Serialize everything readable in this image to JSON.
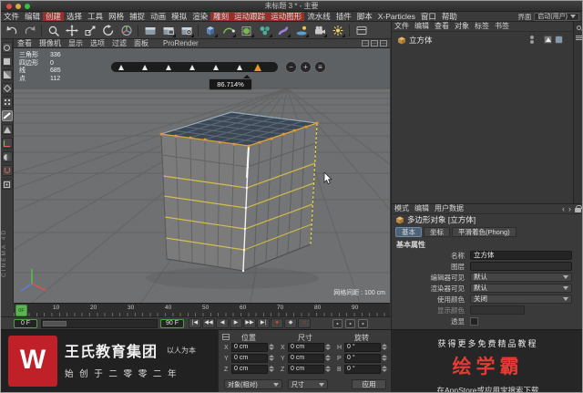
{
  "window": {
    "title": "未标题 3 * - 主要"
  },
  "menubar": {
    "items": [
      "文件",
      "编辑",
      "创建",
      "选择",
      "工具",
      "网格",
      "捕捉",
      "动画",
      "模拟",
      "渲染",
      "雕刻",
      "运动跟踪",
      "运动图形",
      "流水线",
      "插件",
      "脚本",
      "X-Particles",
      "窗口",
      "帮助"
    ],
    "interface_label": "界面",
    "interface_value": "启动(用户)"
  },
  "viewport": {
    "menus": [
      "查看",
      "摄像机",
      "显示",
      "选项",
      "过滤",
      "面板"
    ],
    "prorender_menu": "ProRender",
    "stats": [
      {
        "label": "三角形",
        "value": "336"
      },
      {
        "label": "四边形",
        "value": "0"
      },
      {
        "label": "线",
        "value": "685"
      },
      {
        "label": "点",
        "value": "112"
      }
    ],
    "grid_label": "网格间距 : 100 cm",
    "hud_value": "86.714%"
  },
  "object_manager": {
    "menus": [
      "文件",
      "编辑",
      "查看",
      "对象",
      "标签",
      "书签"
    ],
    "objects": [
      {
        "name": "立方体"
      }
    ]
  },
  "attribute_manager": {
    "menus": [
      "模式",
      "编辑",
      "用户数据"
    ],
    "title": "多边形对象 [立方体]",
    "tabs": [
      "基本",
      "坐标",
      "平滑着色(Phong)"
    ],
    "section": "基本属性",
    "rows": [
      {
        "label": "名称",
        "value": "立方体"
      },
      {
        "label": "图层",
        "value": ""
      },
      {
        "label": "编辑器可见",
        "value": "默认"
      },
      {
        "label": "渲染器可见",
        "value": "默认"
      },
      {
        "label": "使用颜色",
        "value": "关闭"
      },
      {
        "label": "显示颜色",
        "value": ""
      },
      {
        "label": "透显",
        "value": ""
      }
    ]
  },
  "timeline": {
    "ticks": [
      "0",
      "10",
      "20",
      "30",
      "40",
      "50",
      "60",
      "70",
      "80",
      "90"
    ],
    "playhead": "0F",
    "start": "0 F",
    "end": "90 F"
  },
  "coordinates": {
    "columns": [
      {
        "title": "位置",
        "rows": [
          {
            "axis": "X",
            "value": "0 cm"
          },
          {
            "axis": "Y",
            "value": "0 cm"
          },
          {
            "axis": "Z",
            "value": "0 cm"
          }
        ]
      },
      {
        "title": "尺寸",
        "rows": [
          {
            "axis": "X",
            "value": "0 cm"
          },
          {
            "axis": "Y",
            "value": "0 cm"
          },
          {
            "axis": "Z",
            "value": "0 cm"
          }
        ]
      },
      {
        "title": "旋转",
        "rows": [
          {
            "axis": "H",
            "value": "0 °"
          },
          {
            "axis": "P",
            "value": "0 °"
          },
          {
            "axis": "B",
            "value": "0 °"
          }
        ]
      }
    ],
    "mode_dropdown": "对象(相对)",
    "size_dropdown": "尺寸",
    "apply_button": "应用"
  },
  "branding": {
    "logo_letter": "W",
    "company": "王氏教育集团",
    "slogan": "以人为本",
    "founded": "始 创 于 二 零 零 二 年",
    "side_text": "CINEMA 4D"
  },
  "promo": {
    "line1": "获得更多免费精品教程",
    "brand": "绘学霸",
    "line2": "在AppStore或应用宝搜索下载"
  },
  "glyphs": {
    "goto_start": "|◀",
    "prev_key": "◀◀",
    "prev_frame": "◀",
    "play": "▶",
    "next_frame": "▶▶",
    "goto_end": "▶|",
    "record": "●",
    "keyframe": "◆",
    "autokey": "○",
    "minus": "−",
    "plus": "+",
    "hud_menu": "≡"
  }
}
